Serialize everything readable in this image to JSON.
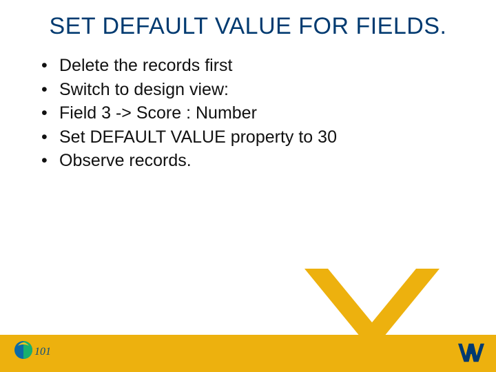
{
  "title": "SET DEFAULT VALUE FOR FIELDS.",
  "bullets": [
    "Delete the records first",
    "Switch to design view:",
    "Field 3 -> Score : Number",
    "Set DEFAULT VALUE property to 30",
    "Observe records."
  ]
}
